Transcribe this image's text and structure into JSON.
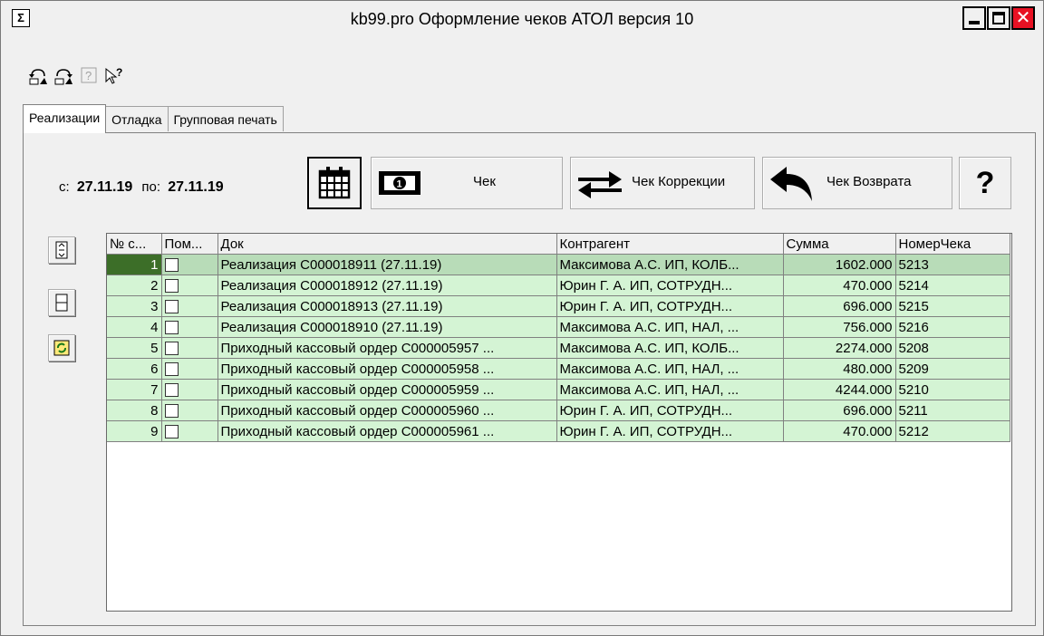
{
  "window": {
    "title": "kb99.pro Оформление чеков АТОЛ версия 10",
    "close_glyph": "✕"
  },
  "toolbar": {
    "icons": [
      "undo-icon",
      "redo-icon",
      "help-disabled-icon",
      "context-help-icon"
    ]
  },
  "tabs": [
    {
      "label": "Реализации",
      "active": true
    },
    {
      "label": "Отладка",
      "active": false
    },
    {
      "label": "Групповая печать",
      "active": false
    }
  ],
  "date_range": {
    "from_label": "с:",
    "from": "27.11.19",
    "to_label": "по:",
    "to": "27.11.19"
  },
  "buttons": {
    "check": "Чек",
    "correction": "Чек Коррекции",
    "return": "Чек Возврата",
    "help": "?"
  },
  "grid": {
    "columns": [
      "№ с...",
      "Пом...",
      "Док",
      "Контрагент",
      "Сумма",
      "НомерЧека"
    ],
    "rows": [
      {
        "n": "1",
        "doc": "Реализация  С000018911 (27.11.19)",
        "agent": "Максимова А.С. ИП, КОЛБ...",
        "sum": "1602.000",
        "check": "5213"
      },
      {
        "n": "2",
        "doc": "Реализация  С000018912 (27.11.19)",
        "agent": "Юрин Г. А. ИП, СОТРУДН...",
        "sum": "470.000",
        "check": "5214"
      },
      {
        "n": "3",
        "doc": "Реализация  С000018913 (27.11.19)",
        "agent": "Юрин Г. А. ИП, СОТРУДН...",
        "sum": "696.000",
        "check": "5215"
      },
      {
        "n": "4",
        "doc": "Реализация  С000018910 (27.11.19)",
        "agent": "Максимова А.С. ИП, НАЛ, ...",
        "sum": "756.000",
        "check": "5216"
      },
      {
        "n": "5",
        "doc": "Приходный кассовый ордер С000005957 ...",
        "agent": "Максимова А.С. ИП, КОЛБ...",
        "sum": "2274.000",
        "check": "5208"
      },
      {
        "n": "6",
        "doc": "Приходный кассовый ордер С000005958 ...",
        "agent": "Максимова А.С. ИП, НАЛ, ...",
        "sum": "480.000",
        "check": "5209"
      },
      {
        "n": "7",
        "doc": "Приходный кассовый ордер С000005959 ...",
        "agent": "Максимова А.С. ИП, НАЛ, ...",
        "sum": "4244.000",
        "check": "5210"
      },
      {
        "n": "8",
        "doc": "Приходный кассовый ордер С000005960 ...",
        "agent": "Юрин Г. А. ИП, СОТРУДН...",
        "sum": "696.000",
        "check": "5211"
      },
      {
        "n": "9",
        "doc": "Приходный кассовый ордер С000005961 ...",
        "agent": "Юрин Г. А. ИП, СОТРУДН...",
        "sum": "470.000",
        "check": "5212"
      }
    ]
  }
}
